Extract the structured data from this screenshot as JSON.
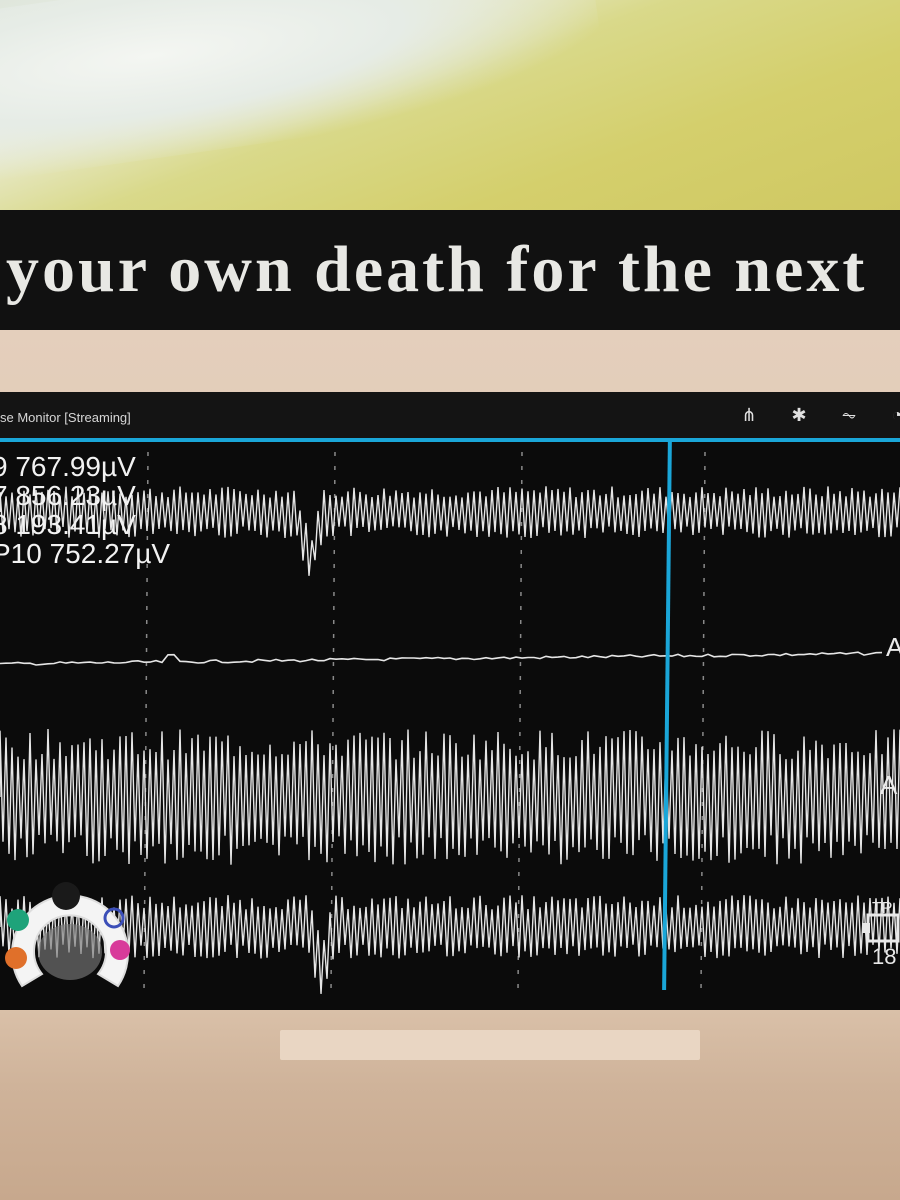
{
  "caption": {
    "text": "your own death for the next"
  },
  "app": {
    "title": "se Monitor [Streaming]",
    "actions": [
      {
        "icon": "share-icon",
        "glyph": "⋔"
      },
      {
        "icon": "gear-icon",
        "glyph": "✱"
      },
      {
        "icon": "heartbeat-icon",
        "glyph": "⏦"
      },
      {
        "icon": "more-icon",
        "glyph": "◔"
      }
    ]
  },
  "readings": [
    "9 767.99µV",
    "7 856.23µV",
    "8 193.41µV",
    "P10 752.27µV"
  ],
  "side_labels": [
    "A",
    "A"
  ],
  "bottom_badge": {
    "label": "TP",
    "number": "18"
  },
  "colors": {
    "accent_blue": "#1aa6d8",
    "trace": "#e6e6e6",
    "ring_dots": [
      "#1a1a1a",
      "#3c4fb8",
      "#d83a9a",
      "#e0702a",
      "#1ea37a"
    ]
  }
}
